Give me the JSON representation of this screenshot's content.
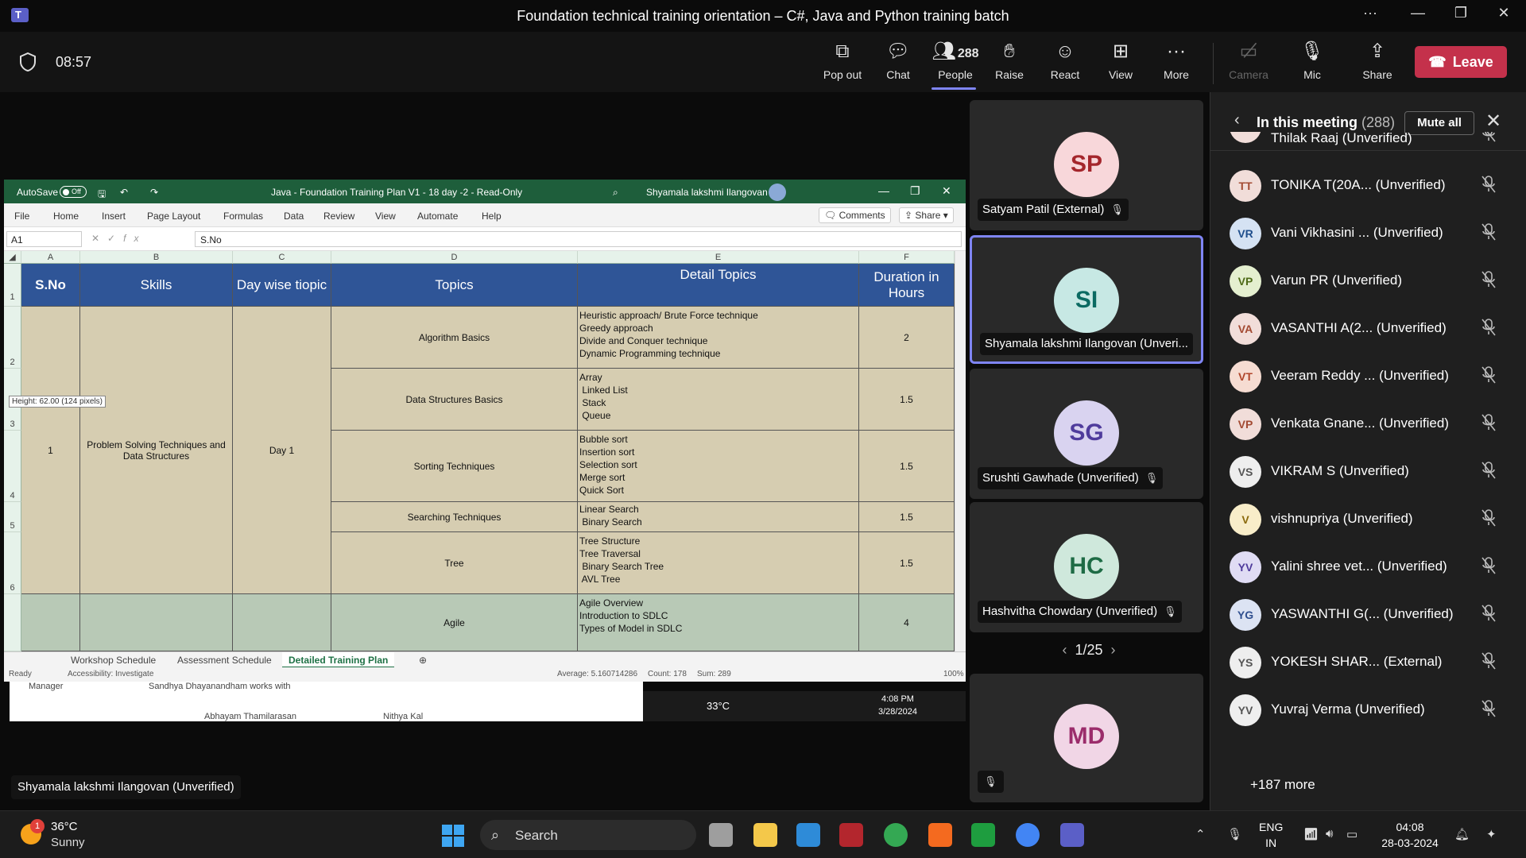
{
  "window": {
    "title": "Foundation technical training orientation – C#, Java and Python training batch",
    "controls": [
      "···",
      "—",
      "❐",
      "✕"
    ]
  },
  "meeting": {
    "timer": "08:57",
    "toolbar": [
      {
        "label": "Pop out",
        "icon": "pop-out-icon"
      },
      {
        "label": "Chat",
        "icon": "chat-icon"
      },
      {
        "label": "People",
        "icon": "people-icon",
        "count": "288"
      },
      {
        "label": "Raise",
        "icon": "hand-icon"
      },
      {
        "label": "React",
        "icon": "smiley-icon"
      },
      {
        "label": "View",
        "icon": "grid-view-icon"
      },
      {
        "label": "More",
        "icon": "more-icon"
      },
      {
        "label": "Camera",
        "icon": "camera-off-icon"
      },
      {
        "label": "Mic",
        "icon": "mic-off-icon"
      },
      {
        "label": "Share",
        "icon": "share-icon"
      }
    ],
    "leave_label": "Leave",
    "accent": "#7f85f5",
    "leave_color": "#c4314b"
  },
  "excel": {
    "autosave": "AutoSave",
    "autosave_state": "Off",
    "file_title": "Java - Foundation Training Plan V1 - 18 day -2  -  Read-Only",
    "user": "Shyamala lakshmi Ilangovan",
    "menu": [
      "File",
      "Home",
      "Insert",
      "Page Layout",
      "Formulas",
      "Data",
      "Review",
      "View",
      "Automate",
      "Help"
    ],
    "comments": "Comments",
    "share": "Share",
    "namebox": "A1",
    "fx": "fx",
    "formula": "S.No",
    "columns": [
      "A",
      "B",
      "C",
      "D",
      "E",
      "F"
    ],
    "rows": [
      "1",
      "2",
      "3",
      "4",
      "5",
      "6"
    ],
    "headers": {
      "sno": "S.No",
      "skills": "Skills",
      "day": "Day wise tiopic",
      "topics": "Topics",
      "detail": "Detail Topics",
      "duration": "Duration  in Hours"
    },
    "merged": {
      "sno": "1",
      "skill": "Problem Solving Techniques and Data Structures",
      "day": "Day 1"
    },
    "topics": [
      {
        "topic": "Algorithm Basics",
        "details": [
          "Heuristic approach/ Brute Force technique",
          "Greedy approach",
          "Divide and Conquer technique",
          "Dynamic Programming technique"
        ],
        "hours": "2"
      },
      {
        "topic": "Data Structures Basics",
        "details": [
          "Array",
          " Linked List",
          " Stack",
          " Queue"
        ],
        "hours": "1.5"
      },
      {
        "topic": "Sorting Techniques",
        "details": [
          "Bubble sort",
          "Insertion sort",
          "Selection sort",
          "Merge sort",
          "Quick Sort"
        ],
        "hours": "1.5"
      },
      {
        "topic": "Searching Techniques",
        "details": [
          "Linear Search",
          " Binary Search"
        ],
        "hours": "1.5"
      },
      {
        "topic": "Tree",
        "details": [
          "Tree Structure",
          "Tree Traversal",
          " Binary Search Tree",
          " AVL Tree"
        ],
        "hours": "1.5"
      },
      {
        "topic": "Agile",
        "details": [
          "Agile Overview",
          "Introduction to SDLC",
          "Types of Model in SDLC"
        ],
        "hours": "4"
      }
    ],
    "row_height_tip": "Height: 62.00 (124 pixels)",
    "sheets": [
      "Workshop Schedule",
      "Assessment Schedule",
      "Detailed Training Plan"
    ],
    "status": {
      "ready": "Ready",
      "accessibility": "Accessibility: Investigate",
      "average": "Average: 5.160714286",
      "count": "Count: 178",
      "sum": "Sum: 289",
      "zoom": "100%"
    }
  },
  "behind_window": {
    "label1": "Manager",
    "label2": "Sandhya Dhayanandham works with",
    "person1": "Abhayam Thamilarasan",
    "person2": "Nithya Kal"
  },
  "mini_tray": {
    "temp": "33°C",
    "time": "4:08 PM",
    "date": "3/28/2024"
  },
  "tiles": [
    {
      "initials": "SP",
      "name": "Satyam Patil (External)",
      "bg": "#f8d7da",
      "fg": "#a4262c",
      "muted": true
    },
    {
      "initials": "SI",
      "name": "Shyamala lakshmi Ilangovan (Unveri...",
      "bg": "#c7e8e4",
      "fg": "#0b6a62",
      "muted": false,
      "active": true
    },
    {
      "initials": "SG",
      "name": "Srushti Gawhade (Unverified)",
      "bg": "#d9d3f0",
      "fg": "#4f3b9c",
      "muted": true
    },
    {
      "initials": "HC",
      "name": "Hashvitha Chowdary (Unverified)",
      "bg": "#cfe8dc",
      "fg": "#1e6b45",
      "muted": true
    },
    {
      "initials": "MD",
      "name": "",
      "bg": "#f1d6e6",
      "fg": "#9b2c6b",
      "muted": true
    }
  ],
  "pager": "1/25",
  "panel": {
    "title": "In this meeting",
    "count": "(288)",
    "mute_all": "Mute all",
    "people": [
      {
        "initials": "TR",
        "name": "Thilak Raaj (Unverified)",
        "bg": "#f1ddd9",
        "fg": "#a34a32"
      },
      {
        "initials": "TT",
        "name": "TONIKA T(20A...  (Unverified)",
        "bg": "#f1ddd9",
        "fg": "#a34a32"
      },
      {
        "initials": "VR",
        "name": "Vani Vikhasini ...  (Unverified)",
        "bg": "#d5e2f3",
        "fg": "#1f4e8c"
      },
      {
        "initials": "VP",
        "name": "Varun PR (Unverified)",
        "bg": "#e4efcf",
        "fg": "#4e6b17"
      },
      {
        "initials": "VA",
        "name": "VASANTHI A(2...  (Unverified)",
        "bg": "#f1ddd9",
        "fg": "#a34a32"
      },
      {
        "initials": "VT",
        "name": "Veeram Reddy ...  (Unverified)",
        "bg": "#f6dcd2",
        "fg": "#b0452a"
      },
      {
        "initials": "VP",
        "name": "Venkata Gnane...  (Unverified)",
        "bg": "#f1ddd9",
        "fg": "#a34a32"
      },
      {
        "initials": "VS",
        "name": "VIKRAM S (Unverified)",
        "bg": "#eeeeee",
        "fg": "#555555"
      },
      {
        "initials": "V",
        "name": "vishnupriya (Unverified)",
        "bg": "#f8edc9",
        "fg": "#8a6a0b"
      },
      {
        "initials": "YV",
        "name": "Yalini shree vet...  (Unverified)",
        "bg": "#e0dcf4",
        "fg": "#4f3b9c"
      },
      {
        "initials": "YG",
        "name": "YASWANTHI G(...  (Unverified)",
        "bg": "#dce3f3",
        "fg": "#2f4f8f"
      },
      {
        "initials": "YS",
        "name": "YOKESH SHAR...  (External)",
        "bg": "#eeeeee",
        "fg": "#555555"
      },
      {
        "initials": "YV",
        "name": "Yuvraj Verma (Unverified)",
        "bg": "#eeeeee",
        "fg": "#555555"
      }
    ],
    "more": "+187 more"
  },
  "self_nametag": "Shyamala lakshmi Ilangovan (Unverified)",
  "taskbar": {
    "weather_badge": "1",
    "temp": "36°C",
    "condition": "Sunny",
    "search": "Search",
    "lang1": "ENG",
    "lang2": "IN",
    "time": "04:08",
    "date": "28-03-2024"
  }
}
